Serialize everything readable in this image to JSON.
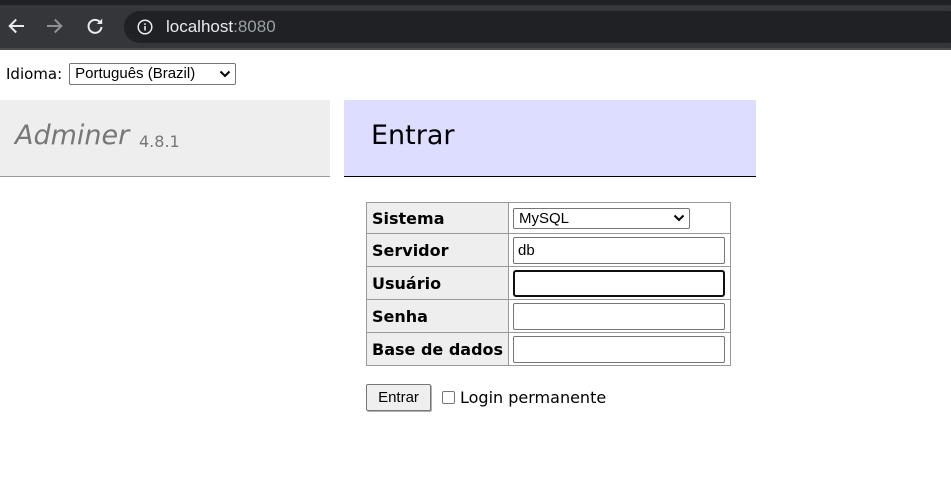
{
  "browser": {
    "url_host": "localhost",
    "url_port": ":8080",
    "icons": {
      "back": "arrow-left-icon",
      "forward": "arrow-right-icon",
      "reload": "reload-icon",
      "site_info": "info-icon"
    }
  },
  "language": {
    "label": "Idioma:",
    "selected": "Português (Brazil)"
  },
  "brand": {
    "name": "Adminer",
    "version": "4.8.1"
  },
  "page": {
    "heading": "Entrar"
  },
  "form": {
    "system": {
      "label": "Sistema",
      "selected": "MySQL"
    },
    "server": {
      "label": "Servidor",
      "value": "db"
    },
    "username": {
      "label": "Usuário",
      "value": ""
    },
    "password": {
      "label": "Senha",
      "value": ""
    },
    "database": {
      "label": "Base de dados",
      "value": ""
    },
    "submit_label": "Entrar",
    "remember_label": "Login permanente",
    "remember_checked": false
  },
  "colors": {
    "chrome_dark": "#35363a",
    "omnibox": "#202124",
    "brand_bg": "#eeeeee",
    "heading_bg": "#ddddff",
    "brand_text": "#777777"
  }
}
